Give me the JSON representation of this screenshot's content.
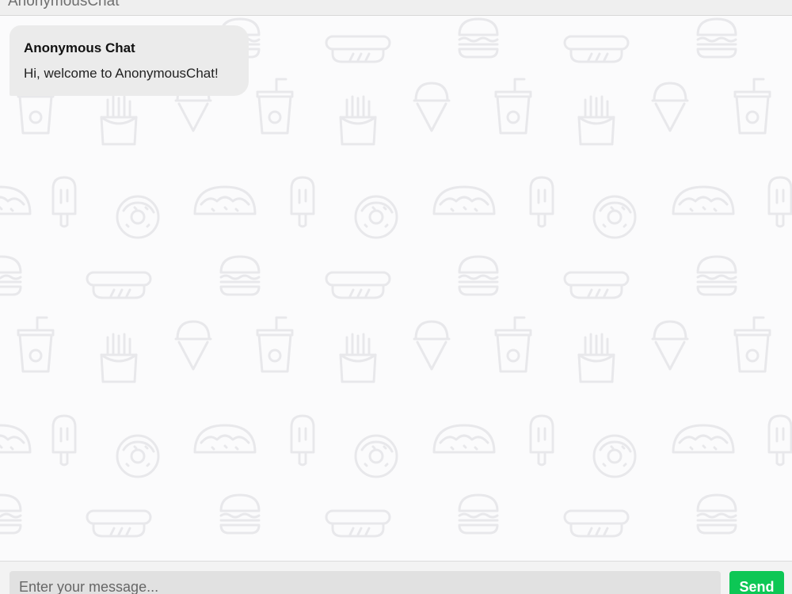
{
  "app": {
    "title": "AnonymousChat"
  },
  "messages": [
    {
      "sender": "Anonymous Chat",
      "text": "Hi, welcome to AnonymousChat!"
    }
  ],
  "composer": {
    "placeholder": "Enter your message...",
    "value": "",
    "send_label": "Send"
  },
  "background": {
    "pattern_icons": [
      "burger-icon",
      "hotdog-icon",
      "soda-cup-icon",
      "fries-icon",
      "ice-cream-cone-icon",
      "popsicle-icon",
      "donut-icon",
      "taco-icon"
    ]
  },
  "colors": {
    "send_button": "#0dc755",
    "message_bubble": "#ebebeb",
    "background": "#fbfbfc",
    "pattern": "#e9e9ec"
  }
}
